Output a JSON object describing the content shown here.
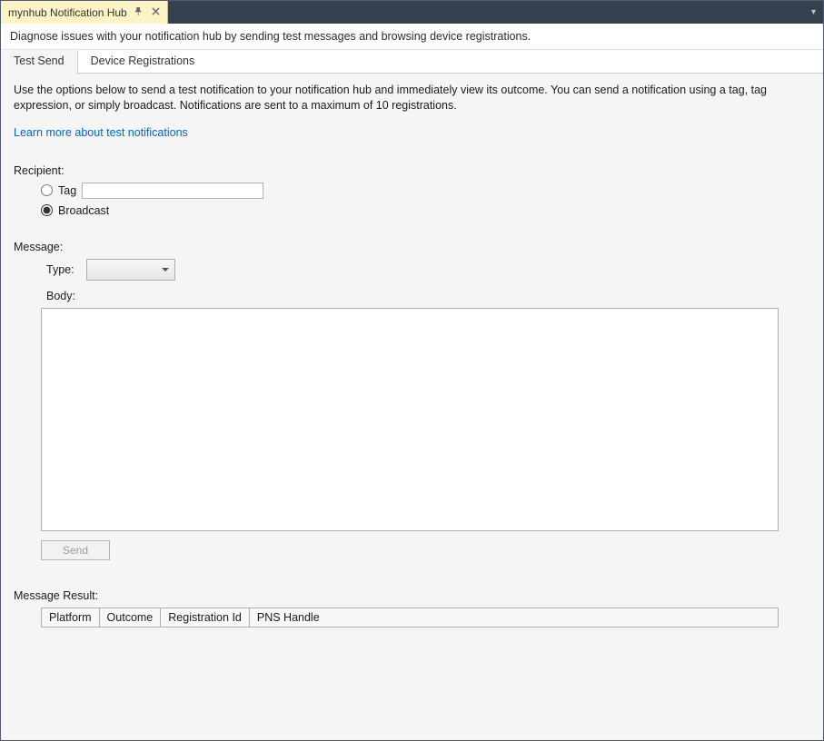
{
  "window": {
    "tab_title": "mynhub Notification Hub",
    "dropdown_icon": "▾"
  },
  "description": "Diagnose issues with your notification hub by sending test messages and browsing device registrations.",
  "subtabs": {
    "test_send": "Test Send",
    "device_registrations": "Device Registrations"
  },
  "intro": "Use the options below to send a test notification to your notification hub and immediately view its outcome. You can send a notification using a tag, tag expression, or simply broadcast. Notifications are sent to a maximum of 10 registrations.",
  "learn_more": "Learn more about test notifications",
  "recipient": {
    "label": "Recipient:",
    "tag_label": "Tag",
    "tag_value": "",
    "broadcast_label": "Broadcast",
    "selected": "broadcast"
  },
  "message": {
    "label": "Message:",
    "type_label": "Type:",
    "type_value": "",
    "body_label": "Body:",
    "body_value": ""
  },
  "send_button": "Send",
  "result": {
    "label": "Message Result:",
    "headers": {
      "platform": "Platform",
      "outcome": "Outcome",
      "registration_id": "Registration Id",
      "pns_handle": "PNS Handle"
    }
  }
}
